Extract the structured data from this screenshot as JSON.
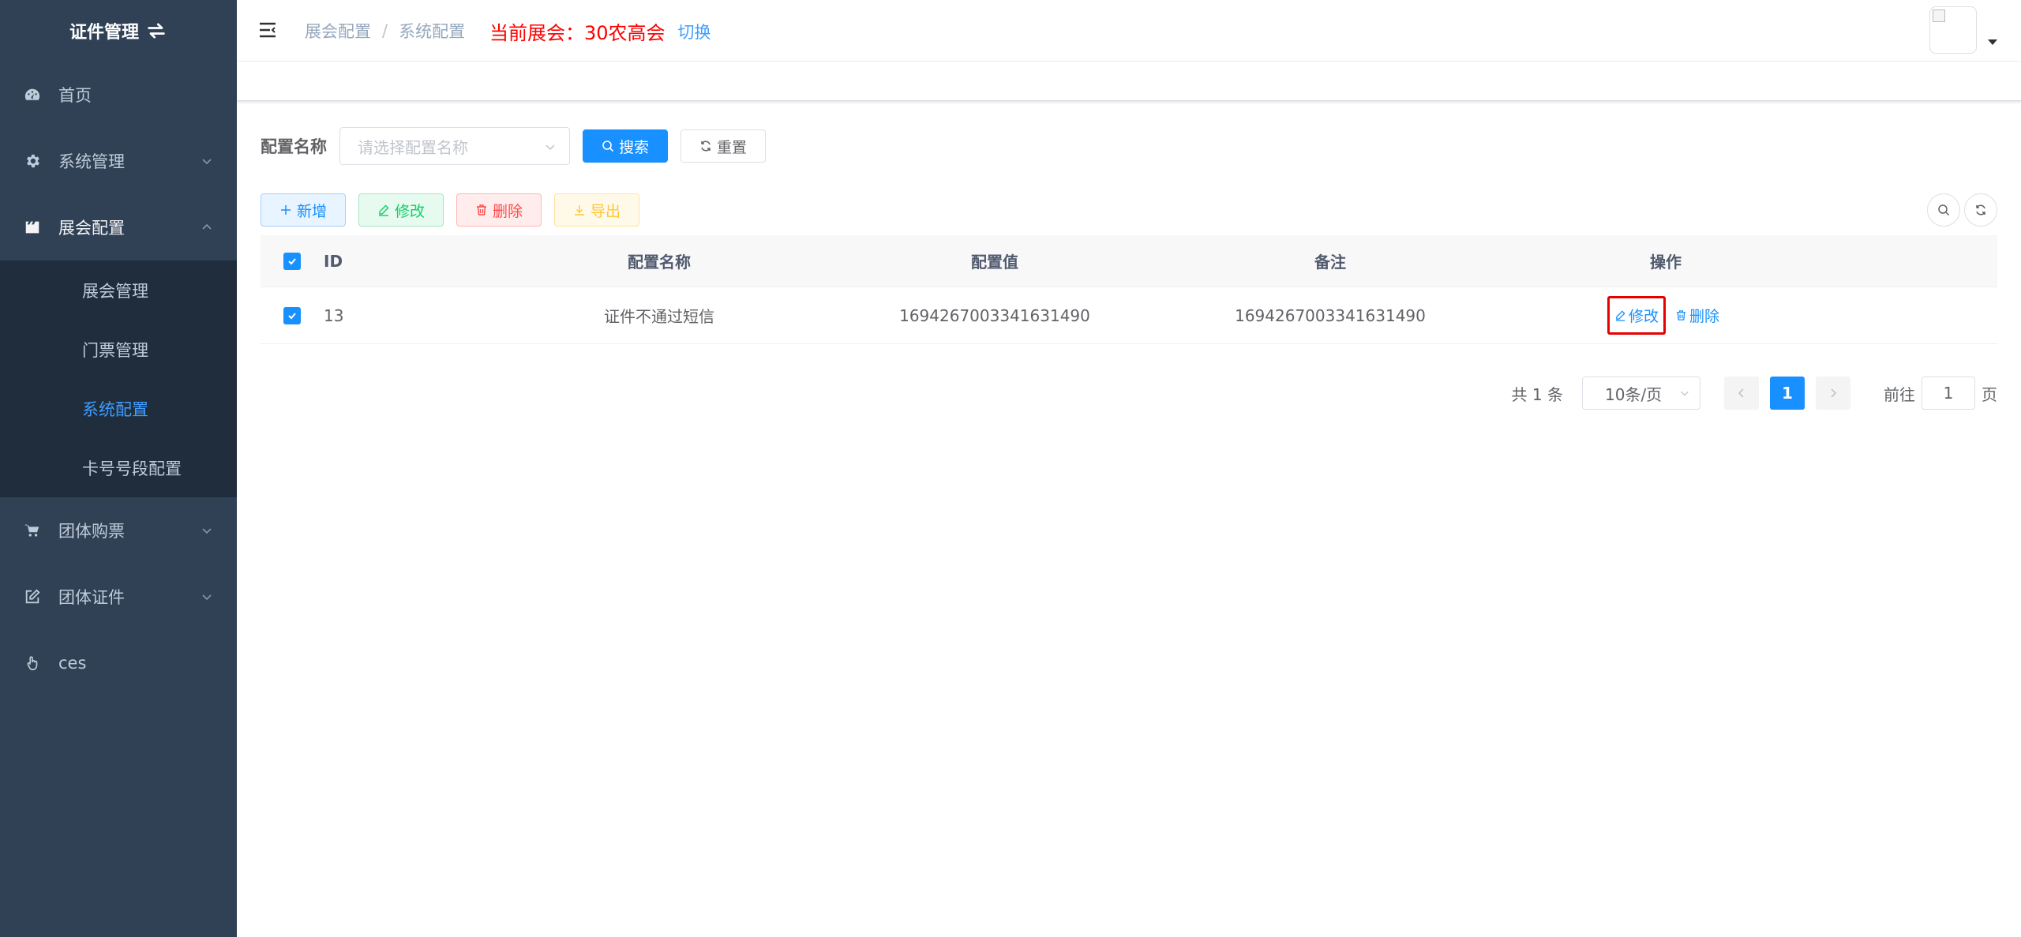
{
  "sidebar": {
    "title": "证件管理",
    "menu": [
      {
        "label": "首页"
      },
      {
        "label": "系统管理"
      },
      {
        "label": "展会配置"
      },
      {
        "label": "团体购票"
      },
      {
        "label": "团体证件"
      },
      {
        "label": "ces"
      }
    ],
    "submenu": [
      {
        "label": "展会管理"
      },
      {
        "label": "门票管理"
      },
      {
        "label": "系统配置"
      },
      {
        "label": "卡号号段配置"
      }
    ]
  },
  "header": {
    "breadcrumb": [
      "展会配置",
      "系统配置"
    ],
    "breadcrumb_sep": "/",
    "current_expo_label": "当前展会：",
    "current_expo_name": "30农高会",
    "switch_label": "切换"
  },
  "search": {
    "label": "配置名称",
    "placeholder": "请选择配置名称",
    "search_label": "搜索",
    "reset_label": "重置"
  },
  "toolbar": {
    "add_label": "新增",
    "edit_label": "修改",
    "delete_label": "删除",
    "export_label": "导出"
  },
  "table": {
    "columns": [
      "ID",
      "配置名称",
      "配置值",
      "备注",
      "操作"
    ],
    "rows": [
      {
        "id": "13",
        "name": "证件不通过短信",
        "value": "1694267003341631490",
        "remark": "1694267003341631490",
        "edit_label": "修改",
        "delete_label": "删除"
      }
    ]
  },
  "pagination": {
    "total_text": "共 1 条",
    "page_size": "10条/页",
    "current_page": "1",
    "goto_label": "前往",
    "goto_value": "1",
    "page_suffix": "页"
  },
  "colors": {
    "sidebar_bg": "#304156",
    "submenu_bg": "#1f2d3d",
    "primary": "#1890ff",
    "active_menu": "#409eff",
    "expo_red": "#ff0000",
    "highlight_border": "#e60000"
  }
}
